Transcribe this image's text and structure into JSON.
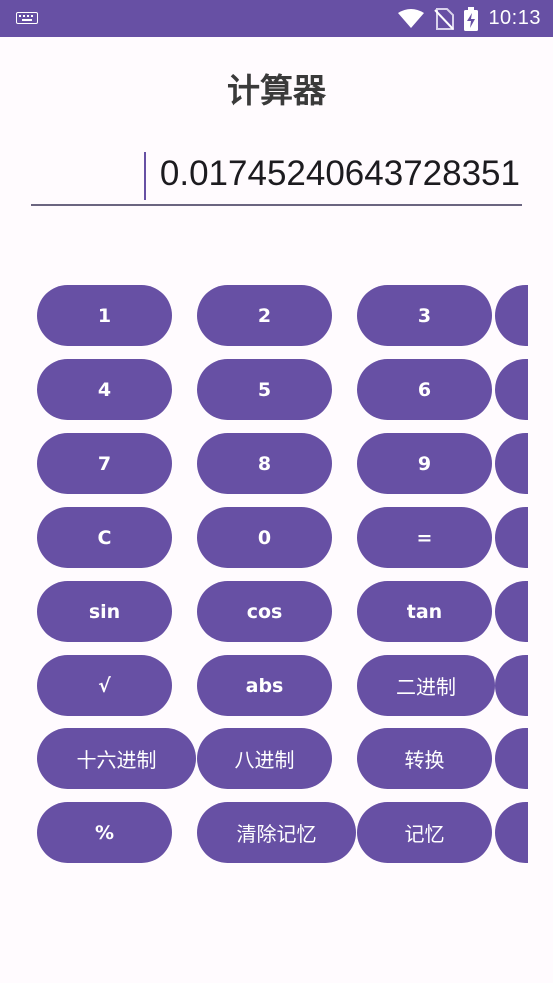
{
  "status_bar": {
    "time": "10:13"
  },
  "app": {
    "title": "计算器"
  },
  "display": {
    "value": "0.01745240643728351"
  },
  "keys": {
    "k1": "1",
    "k2": "2",
    "k3": "3",
    "k4": "4",
    "k5": "5",
    "k6": "6",
    "k7": "7",
    "k8": "8",
    "k9": "9",
    "clear": "C",
    "k0": "0",
    "equals": "=",
    "sin": "sin",
    "cos": "cos",
    "tan": "tan",
    "sqrt": "√",
    "abs": "abs",
    "binary": "二进制",
    "hex": "十六进制",
    "octal": "八进制",
    "convert": "转换",
    "percent": "%",
    "clear_memory": "清除记忆",
    "memory": "记忆"
  },
  "colors": {
    "accent": "#6750A4",
    "background": "#FFFBFE",
    "status_bar": "#6750A4"
  }
}
